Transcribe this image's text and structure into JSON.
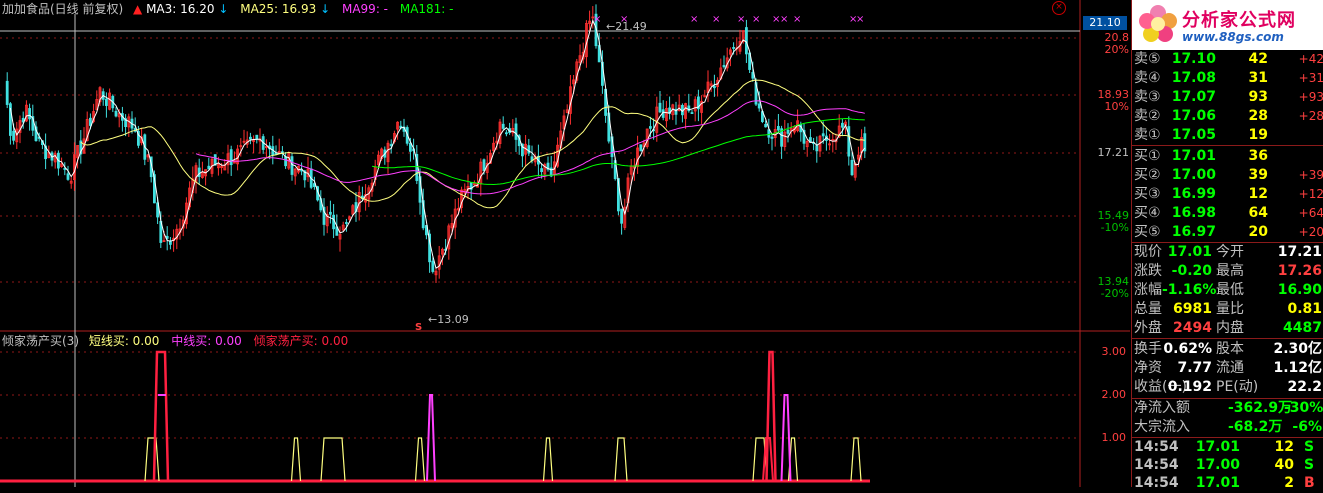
{
  "header": {
    "title": "加加食品(日线 前复权)",
    "ma3_label": "MA3: 16.20",
    "ma25_label": "MA25: 16.93",
    "ma99_label": "MA99: -",
    "ma181_label": "MA181: -",
    "close_icon": "close-icon",
    "colors": {
      "ma3": "#ffffff",
      "ma25": "#ffff80",
      "ma99": "#ff40ff",
      "ma181": "#00ff00"
    }
  },
  "price_axis": {
    "current_price": "21.10",
    "ticks": [
      {
        "value": "20.8",
        "pct": "20%"
      },
      {
        "value": "18.93",
        "pct": "10%"
      },
      {
        "value": "17.21",
        "pct": ""
      },
      {
        "value": "15.49",
        "pct": "-10%"
      },
      {
        "value": "13.94",
        "pct": "-20%"
      }
    ],
    "high_label": "21.49",
    "low_label": "13.09",
    "low_marker": "S"
  },
  "indicator": {
    "title": "倾家荡产买(3)",
    "short_label": "短线买: 0.00",
    "mid_label": "中线买: 0.00",
    "all_in_label": "倾家荡产买: 0.00",
    "ticks": [
      "3.00",
      "2.00",
      "1.00"
    ],
    "colors": {
      "short": "#ffff80",
      "mid": "#ff40ff",
      "all_in": "#ff2040"
    }
  },
  "logo": {
    "name": "分析家公式网",
    "url": "www.88gs.com",
    "icon": "flower-logo-icon"
  },
  "order_book": {
    "sell": [
      {
        "label": "卖⑤",
        "price": "17.10",
        "vol": "42",
        "chg": "+42"
      },
      {
        "label": "卖④",
        "price": "17.08",
        "vol": "31",
        "chg": "+31"
      },
      {
        "label": "卖③",
        "price": "17.07",
        "vol": "93",
        "chg": "+93"
      },
      {
        "label": "卖②",
        "price": "17.06",
        "vol": "28",
        "chg": "+28"
      },
      {
        "label": "卖①",
        "price": "17.05",
        "vol": "19",
        "chg": ""
      }
    ],
    "buy": [
      {
        "label": "买①",
        "price": "17.01",
        "vol": "36",
        "chg": ""
      },
      {
        "label": "买②",
        "price": "17.00",
        "vol": "39",
        "chg": "+39"
      },
      {
        "label": "买③",
        "price": "16.99",
        "vol": "12",
        "chg": "+12"
      },
      {
        "label": "买④",
        "price": "16.98",
        "vol": "64",
        "chg": "+64"
      },
      {
        "label": "买⑤",
        "price": "16.97",
        "vol": "20",
        "chg": "+20"
      }
    ]
  },
  "quote": [
    {
      "l1": "现价",
      "v1": "17.01",
      "c1": "g",
      "l2": "今开",
      "v2": "17.21",
      "c2": "w"
    },
    {
      "l1": "涨跌",
      "v1": "-0.20",
      "c1": "g",
      "l2": "最高",
      "v2": "17.26",
      "c2": "r"
    },
    {
      "l1": "涨幅",
      "v1": "-1.16%",
      "c1": "g",
      "l2": "最低",
      "v2": "16.90",
      "c2": "g"
    },
    {
      "l1": "总量",
      "v1": "6981",
      "c1": "y",
      "l2": "量比",
      "v2": "0.81",
      "c2": "y"
    },
    {
      "l1": "外盘",
      "v1": "2494",
      "c1": "r",
      "l2": "内盘",
      "v2": "4487",
      "c2": "g"
    }
  ],
  "fundamentals": [
    {
      "l1": "换手",
      "v1": "0.62%",
      "c1": "w",
      "l2": "股本",
      "v2": "2.30亿",
      "c2": "w"
    },
    {
      "l1": "净资",
      "v1": "7.77",
      "c1": "w",
      "l2": "流通",
      "v2": "1.12亿",
      "c2": "w"
    },
    {
      "l1": "收益(一)",
      "v1": "0.192",
      "c1": "w",
      "l2": "PE(动)",
      "v2": "22.2",
      "c2": "w"
    }
  ],
  "flows": [
    {
      "label": "净流入额",
      "value": "-362.9万",
      "pct": "-30%"
    },
    {
      "label": "大宗流入",
      "value": "-68.2万",
      "pct": "-6%"
    }
  ],
  "ticks": [
    {
      "time": "14:54",
      "price": "17.01",
      "vol": "12",
      "side": "S",
      "side_color": "g"
    },
    {
      "time": "14:54",
      "price": "17.00",
      "vol": "40",
      "side": "S",
      "side_color": "g"
    },
    {
      "time": "14:54",
      "price": "17.01",
      "vol": "2",
      "side": "B",
      "side_color": "r"
    }
  ]
}
